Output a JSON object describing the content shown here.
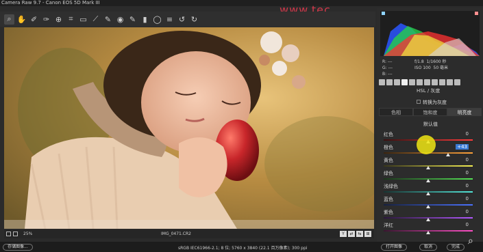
{
  "window": {
    "title": "Camera Raw 9.7 - Canon EOS 5D Mark III"
  },
  "watermark": "www.tec...",
  "toolbar": {
    "tools": [
      {
        "name": "zoom-tool-icon",
        "glyph": "⌕"
      },
      {
        "name": "hand-tool-icon",
        "glyph": "✋"
      },
      {
        "name": "white-balance-tool-icon",
        "glyph": "✐"
      },
      {
        "name": "color-sampler-icon",
        "glyph": "✑"
      },
      {
        "name": "targeted-adjustment-icon",
        "glyph": "⊕"
      },
      {
        "name": "crop-tool-icon",
        "glyph": "⌗"
      },
      {
        "name": "straighten-tool-icon",
        "glyph": "▭"
      },
      {
        "name": "transform-tool-icon",
        "glyph": "⟋"
      },
      {
        "name": "spot-removal-icon",
        "glyph": "✎"
      },
      {
        "name": "red-eye-icon",
        "glyph": "◉"
      },
      {
        "name": "adjustment-brush-icon",
        "glyph": "✎"
      },
      {
        "name": "graduated-filter-icon",
        "glyph": "▮"
      },
      {
        "name": "radial-filter-icon",
        "glyph": "◯"
      },
      {
        "name": "preferences-icon",
        "glyph": "≡"
      },
      {
        "name": "rotate-ccw-icon",
        "glyph": "↺"
      },
      {
        "name": "rotate-cw-icon",
        "glyph": "↻"
      }
    ]
  },
  "status": {
    "zoom": "25%",
    "filename": "IMG_0471.CR2"
  },
  "metadata": {
    "r": "R: ---",
    "g": "G: ---",
    "b": "B: ---",
    "aperture": "f/1.8",
    "shutter": "1/1600 秒",
    "iso": "ISO 100",
    "focal": "50 毫米"
  },
  "panel": {
    "section_title": "HSL / 灰度",
    "convert_label": "转换为灰度",
    "tabs": [
      {
        "label": "色相",
        "active": false
      },
      {
        "label": "饱和度",
        "active": false
      },
      {
        "label": "明亮度",
        "active": true
      }
    ],
    "default_label": "默认值",
    "sliders": [
      {
        "label": "红色",
        "value": "0",
        "pos": 0.5,
        "color": "linear-gradient(90deg,#3a1010,#ff3b3b)"
      },
      {
        "label": "橙色",
        "value": "+43",
        "pos": 0.72,
        "color": "linear-gradient(90deg,#3a240e,#ffa23a)",
        "highlight": true
      },
      {
        "label": "黄色",
        "value": "0",
        "pos": 0.5,
        "color": "linear-gradient(90deg,#38361a,#f5ef52)"
      },
      {
        "label": "绿色",
        "value": "0",
        "pos": 0.5,
        "color": "linear-gradient(90deg,#1b361b,#55e355)"
      },
      {
        "label": "浅绿色",
        "value": "0",
        "pos": 0.5,
        "color": "linear-gradient(90deg,#173432,#53e6d8)"
      },
      {
        "label": "蓝色",
        "value": "0",
        "pos": 0.5,
        "color": "linear-gradient(90deg,#16203f,#4b72ff)"
      },
      {
        "label": "紫色",
        "value": "0",
        "pos": 0.5,
        "color": "linear-gradient(90deg,#2a173b,#b258ff)"
      },
      {
        "label": "洋红",
        "value": "0",
        "pos": 0.5,
        "color": "linear-gradient(90deg,#3a1530,#ff4fc6)"
      }
    ]
  },
  "footer": {
    "save_label": "存储图像...",
    "workflow_info": "sRGB IEC61966-2.1; 8 位; 5760 x 3840 (22.1 百万像素); 300 ppi",
    "open_label": "打开图像",
    "cancel_label": "取消",
    "done_label": "完成"
  }
}
